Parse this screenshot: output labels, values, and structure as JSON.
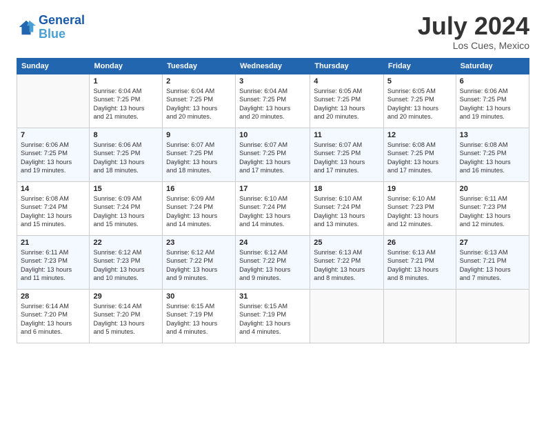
{
  "header": {
    "logo_line1": "General",
    "logo_line2": "Blue",
    "title": "July 2024",
    "location": "Los Cues, Mexico"
  },
  "weekdays": [
    "Sunday",
    "Monday",
    "Tuesday",
    "Wednesday",
    "Thursday",
    "Friday",
    "Saturday"
  ],
  "weeks": [
    [
      {
        "day": "",
        "sunrise": "",
        "sunset": "",
        "daylight": ""
      },
      {
        "day": "1",
        "sunrise": "6:04 AM",
        "sunset": "7:25 PM",
        "hours": "13",
        "minutes": "21"
      },
      {
        "day": "2",
        "sunrise": "6:04 AM",
        "sunset": "7:25 PM",
        "hours": "13",
        "minutes": "20"
      },
      {
        "day": "3",
        "sunrise": "6:04 AM",
        "sunset": "7:25 PM",
        "hours": "13",
        "minutes": "20"
      },
      {
        "day": "4",
        "sunrise": "6:05 AM",
        "sunset": "7:25 PM",
        "hours": "13",
        "minutes": "20"
      },
      {
        "day": "5",
        "sunrise": "6:05 AM",
        "sunset": "7:25 PM",
        "hours": "13",
        "minutes": "20"
      },
      {
        "day": "6",
        "sunrise": "6:06 AM",
        "sunset": "7:25 PM",
        "hours": "13",
        "minutes": "19"
      }
    ],
    [
      {
        "day": "7",
        "sunrise": "6:06 AM",
        "sunset": "7:25 PM",
        "hours": "13",
        "minutes": "19"
      },
      {
        "day": "8",
        "sunrise": "6:06 AM",
        "sunset": "7:25 PM",
        "hours": "13",
        "minutes": "18"
      },
      {
        "day": "9",
        "sunrise": "6:07 AM",
        "sunset": "7:25 PM",
        "hours": "13",
        "minutes": "18"
      },
      {
        "day": "10",
        "sunrise": "6:07 AM",
        "sunset": "7:25 PM",
        "hours": "13",
        "minutes": "17"
      },
      {
        "day": "11",
        "sunrise": "6:07 AM",
        "sunset": "7:25 PM",
        "hours": "13",
        "minutes": "17"
      },
      {
        "day": "12",
        "sunrise": "6:08 AM",
        "sunset": "7:25 PM",
        "hours": "13",
        "minutes": "17"
      },
      {
        "day": "13",
        "sunrise": "6:08 AM",
        "sunset": "7:25 PM",
        "hours": "13",
        "minutes": "16"
      }
    ],
    [
      {
        "day": "14",
        "sunrise": "6:08 AM",
        "sunset": "7:24 PM",
        "hours": "13",
        "minutes": "15"
      },
      {
        "day": "15",
        "sunrise": "6:09 AM",
        "sunset": "7:24 PM",
        "hours": "13",
        "minutes": "15"
      },
      {
        "day": "16",
        "sunrise": "6:09 AM",
        "sunset": "7:24 PM",
        "hours": "13",
        "minutes": "14"
      },
      {
        "day": "17",
        "sunrise": "6:10 AM",
        "sunset": "7:24 PM",
        "hours": "13",
        "minutes": "14"
      },
      {
        "day": "18",
        "sunrise": "6:10 AM",
        "sunset": "7:24 PM",
        "hours": "13",
        "minutes": "13"
      },
      {
        "day": "19",
        "sunrise": "6:10 AM",
        "sunset": "7:23 PM",
        "hours": "13",
        "minutes": "12"
      },
      {
        "day": "20",
        "sunrise": "6:11 AM",
        "sunset": "7:23 PM",
        "hours": "13",
        "minutes": "12"
      }
    ],
    [
      {
        "day": "21",
        "sunrise": "6:11 AM",
        "sunset": "7:23 PM",
        "hours": "13",
        "minutes": "11"
      },
      {
        "day": "22",
        "sunrise": "6:12 AM",
        "sunset": "7:23 PM",
        "hours": "13",
        "minutes": "10"
      },
      {
        "day": "23",
        "sunrise": "6:12 AM",
        "sunset": "7:22 PM",
        "hours": "13",
        "minutes": "9"
      },
      {
        "day": "24",
        "sunrise": "6:12 AM",
        "sunset": "7:22 PM",
        "hours": "13",
        "minutes": "9"
      },
      {
        "day": "25",
        "sunrise": "6:13 AM",
        "sunset": "7:22 PM",
        "hours": "13",
        "minutes": "8"
      },
      {
        "day": "26",
        "sunrise": "6:13 AM",
        "sunset": "7:21 PM",
        "hours": "13",
        "minutes": "8"
      },
      {
        "day": "27",
        "sunrise": "6:13 AM",
        "sunset": "7:21 PM",
        "hours": "13",
        "minutes": "7"
      }
    ],
    [
      {
        "day": "28",
        "sunrise": "6:14 AM",
        "sunset": "7:20 PM",
        "hours": "13",
        "minutes": "6"
      },
      {
        "day": "29",
        "sunrise": "6:14 AM",
        "sunset": "7:20 PM",
        "hours": "13",
        "minutes": "5"
      },
      {
        "day": "30",
        "sunrise": "6:15 AM",
        "sunset": "7:19 PM",
        "hours": "13",
        "minutes": "4"
      },
      {
        "day": "31",
        "sunrise": "6:15 AM",
        "sunset": "7:19 PM",
        "hours": "13",
        "minutes": "4"
      },
      {
        "day": "",
        "sunrise": "",
        "sunset": "",
        "hours": "",
        "minutes": ""
      },
      {
        "day": "",
        "sunrise": "",
        "sunset": "",
        "hours": "",
        "minutes": ""
      },
      {
        "day": "",
        "sunrise": "",
        "sunset": "",
        "hours": "",
        "minutes": ""
      }
    ]
  ]
}
